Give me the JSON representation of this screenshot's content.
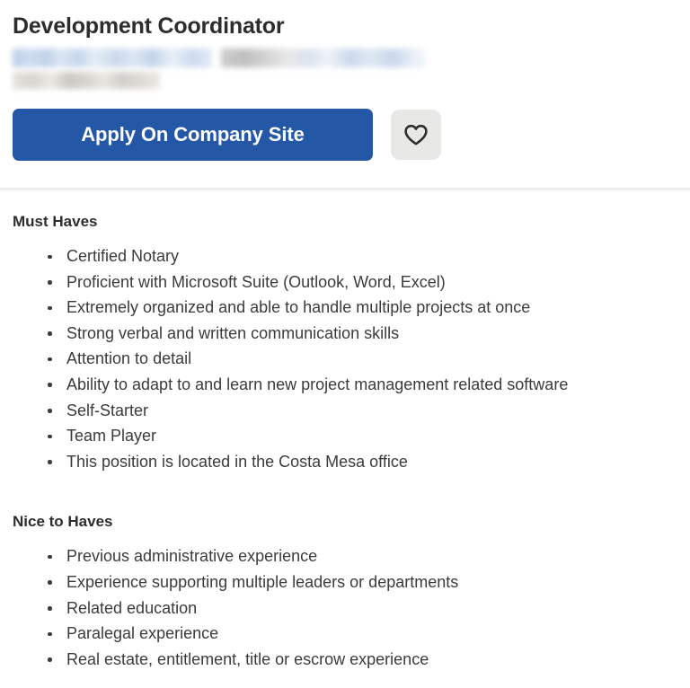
{
  "job": {
    "title": "Development Coordinator",
    "meta_redacted": {
      "company_placeholder": "",
      "location_placeholder": "",
      "secondary_placeholder": ""
    }
  },
  "actions": {
    "apply_label": "Apply On Company Site",
    "save_icon": "heart-icon",
    "accent_color": "#2557a7",
    "save_button_color": "#e8e8e6"
  },
  "description": {
    "sections": [
      {
        "heading": "Must Haves",
        "items": [
          "Certified Notary",
          "Proficient with Microsoft Suite (Outlook, Word, Excel)",
          "Extremely organized and able to handle multiple projects at once",
          "Strong verbal and written communication skills",
          "Attention to detail",
          "Ability to adapt to and learn new project management related software",
          "Self-Starter",
          "Team Player",
          "This position is located in the Costa Mesa office"
        ]
      },
      {
        "heading": "Nice to Haves",
        "items": [
          "Previous administrative experience",
          "Experience supporting multiple leaders or departments",
          "Related education",
          "Paralegal experience",
          "Real estate, entitlement, title or escrow experience"
        ]
      }
    ]
  }
}
